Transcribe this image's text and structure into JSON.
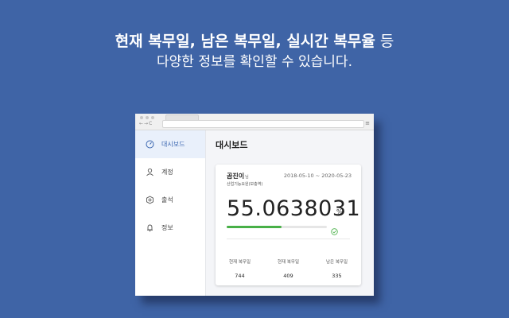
{
  "headline": {
    "line1_bold1": "현재 복무일, 남은 복무일, 실시간 복무율",
    "line1_rest": " 등",
    "line2": "다양한 정보를 확인할 수 있습니다."
  },
  "sidebar": {
    "items": [
      {
        "label": "대시보드",
        "icon": "dashboard-gauge-icon",
        "active": true
      },
      {
        "label": "계정",
        "icon": "user-icon",
        "active": false
      },
      {
        "label": "출석",
        "icon": "badge-icon",
        "active": false
      },
      {
        "label": "정보",
        "icon": "bell-icon",
        "active": false
      }
    ]
  },
  "main": {
    "title": "대시보드",
    "card": {
      "name": "곰진이",
      "name_suffix": "님",
      "period": "2018-05-10 ~ 2020-05-23",
      "org": "산업기능요원(보충역)",
      "rate": "55.0638031",
      "rate_unit": "%",
      "progress_fraction": 0.55,
      "stats": [
        {
          "label": "현재 복무일",
          "value": "744"
        },
        {
          "label": "현재 복무일",
          "value": "409"
        },
        {
          "label": "남은 복무일",
          "value": "335"
        }
      ]
    }
  },
  "colors": {
    "background": "#3f64a6",
    "accent": "#3a66b0",
    "progress": "#48b047"
  }
}
